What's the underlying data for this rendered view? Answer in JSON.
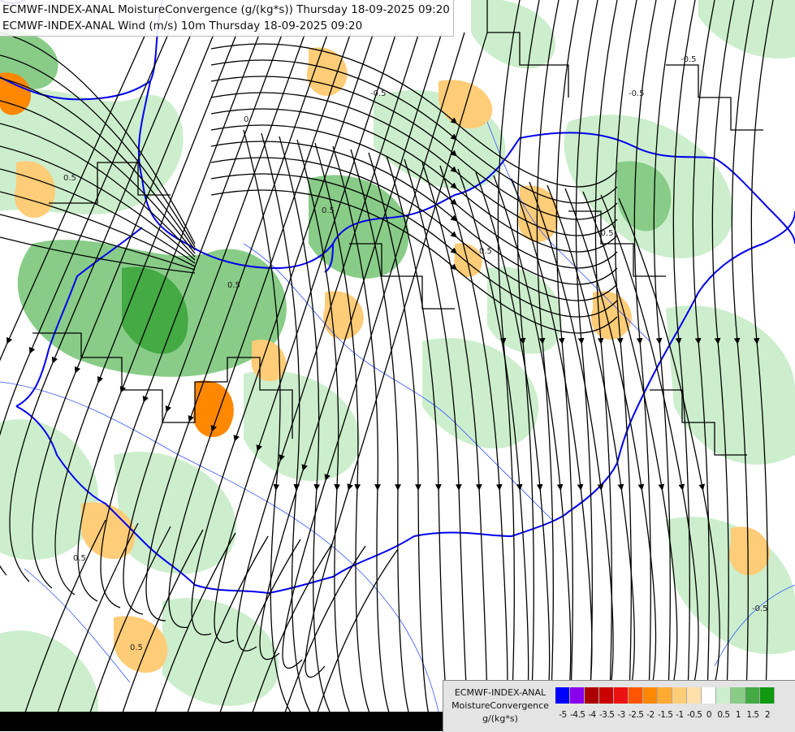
{
  "title": {
    "line1": "ECMWF-INDEX-ANAL MoistureConvergence (g/(kg*s)) Thursday 18-09-2025 09:20",
    "line2": "ECMWF-INDEX-ANAL Wind (m/s) 10m Thursday 18-09-2025 09:20"
  },
  "legend": {
    "line1": "ECMWF-INDEX-ANAL",
    "line2": "MoistureConvergence",
    "line3": "g/(kg*s)",
    "tick_labels": [
      "-5",
      "-4.5",
      "-4",
      "-3.5",
      "-3",
      "-2.5",
      "-2",
      "-1.5",
      "-1",
      "-0.5",
      "0",
      "0.5",
      "1",
      "1.5",
      "2"
    ],
    "colors": [
      "#0000ff",
      "#8800ee",
      "#aa0000",
      "#cc0000",
      "#ee1111",
      "#ff5500",
      "#ff8800",
      "#ffaa33",
      "#ffcc77",
      "#ffe0aa",
      "#ffffff",
      "#cceecc",
      "#88cc88",
      "#44aa44",
      "#119911"
    ]
  },
  "map_labels": {
    "contour_values": [
      "0.5",
      "0",
      "-0.5",
      "-0.5",
      "0.5",
      "0.5",
      "-0.5",
      "-0.5",
      "0.5",
      "0.5",
      "-0.5",
      "0.5"
    ]
  }
}
